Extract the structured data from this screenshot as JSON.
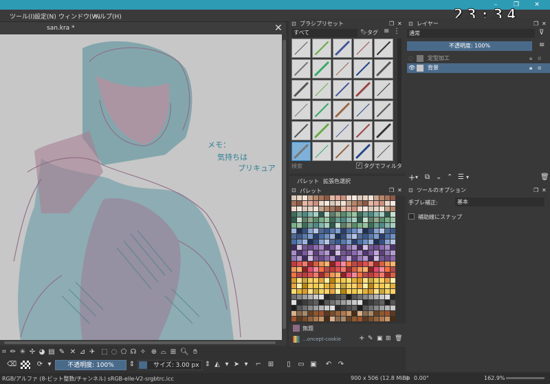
{
  "clock": "23:34",
  "menubar": {
    "items": [
      "ツール(I)",
      "設定(N)",
      "ウィンドウ(W)",
      "ヘルプ(H)"
    ]
  },
  "document": {
    "tab_title": "san.kra *"
  },
  "canvas_note": {
    "line1": "メモ：",
    "line2": "気持ちは",
    "line3": "プリキュア"
  },
  "brush_presets": {
    "title": "ブラシプリセット",
    "filter_value": "すべて",
    "tag_label": "タグ",
    "search_placeholder": "検索",
    "tag_filter_label": "タグでフィルタ"
  },
  "palette": {
    "tabs": [
      "パレット",
      "拡張色選択"
    ],
    "title": "パレット",
    "swatch_name": "無題",
    "palette_name": "...oncept-cookie",
    "colors": {
      "light": [
        "#d9c7b8",
        "#e8d4c4",
        "#f2e3d6",
        "#c7a48c",
        "#b8866a",
        "#a6735a",
        "#8c5a46",
        "#e6b8a2",
        "#dfa99a",
        "#cc8f7d",
        "#efd9cc",
        "#f6e8df"
      ],
      "green": [
        "#5a8c6e",
        "#7ab08a",
        "#9cc4a3",
        "#3e6e58",
        "#6b9c8f",
        "#4f8a86",
        "#86b6ac",
        "#a7d0c2",
        "#2f5a4e",
        "#c6dfcf",
        "#5e7e6a",
        "#91a889"
      ],
      "blue": [
        "#3a5a8c",
        "#5a7ab0",
        "#7f9fd0",
        "#2c3e6b",
        "#4a6fa5",
        "#6f8fc5",
        "#9fb4dd",
        "#1f2f52",
        "#35507f",
        "#8aa2cf",
        "#b7c6e4",
        "#506a94"
      ],
      "purple": [
        "#6a4a8c",
        "#8c6ab0",
        "#a98cc8",
        "#4e3670",
        "#7a5a9e",
        "#c2a7d8",
        "#5c3f7a",
        "#9478b5",
        "#b59ad1",
        "#3f2a5c",
        "#d4c0e4",
        "#725891"
      ],
      "red": [
        "#c23b3b",
        "#e05050",
        "#f07a6a",
        "#a02c2c",
        "#d9603f",
        "#f0955a",
        "#ffb36b",
        "#8c2222",
        "#e84a6a",
        "#f28aa0",
        "#ff6f3c",
        "#b84a4a"
      ],
      "yellow": [
        "#f2c94c",
        "#f7dc6f",
        "#e6b33a",
        "#d99b2a",
        "#ffe38a",
        "#c9a640",
        "#f4d35e",
        "#ffd166",
        "#e8a33d",
        "#fff1a8",
        "#b8860b",
        "#ffcf5c"
      ],
      "dark": [
        "#2a2a2a",
        "#3c3c3c",
        "#4e4e4e",
        "#606060",
        "#1e1e1e",
        "#575757",
        "#707070",
        "#888888",
        "#9e9e9e",
        "#b4b4b4",
        "#cacaca",
        "#e0e0e0"
      ],
      "brown": [
        "#6b4226",
        "#8b5a2b",
        "#a0522d",
        "#5c3a21",
        "#7a4e2d",
        "#94643d",
        "#b07a4f",
        "#c99667",
        "#4a2c17",
        "#d8b08c",
        "#8a6a4e",
        "#a88b6c"
      ]
    }
  },
  "layers": {
    "title": "レイヤー",
    "blend_mode": "通常",
    "opacity_label": "不透明度: 100%",
    "items": [
      {
        "name": "定型加工",
        "selected": false
      },
      {
        "name": "背景",
        "selected": true
      }
    ]
  },
  "tool_options": {
    "title": "ツールのオプション",
    "stabilizer_label": "手ブレ補正:",
    "stabilizer_value": "基本",
    "snap_label": "補助線にスナップ"
  },
  "toolbar": {
    "opacity_label": "不透明度: 100%",
    "size_label": "サイズ: 3.00 px"
  },
  "status": {
    "color_profile": "RGB/アルファ (8-ビット整数/チャンネル)  sRGB-elle-V2-srgbtrc.icc",
    "dimensions": "900 x 506 (12.8 MiB)",
    "rotation": "0.00°",
    "zoom": "162.9%"
  },
  "accent_color": "#2e9bb5",
  "selection_color": "#4a6a8a"
}
